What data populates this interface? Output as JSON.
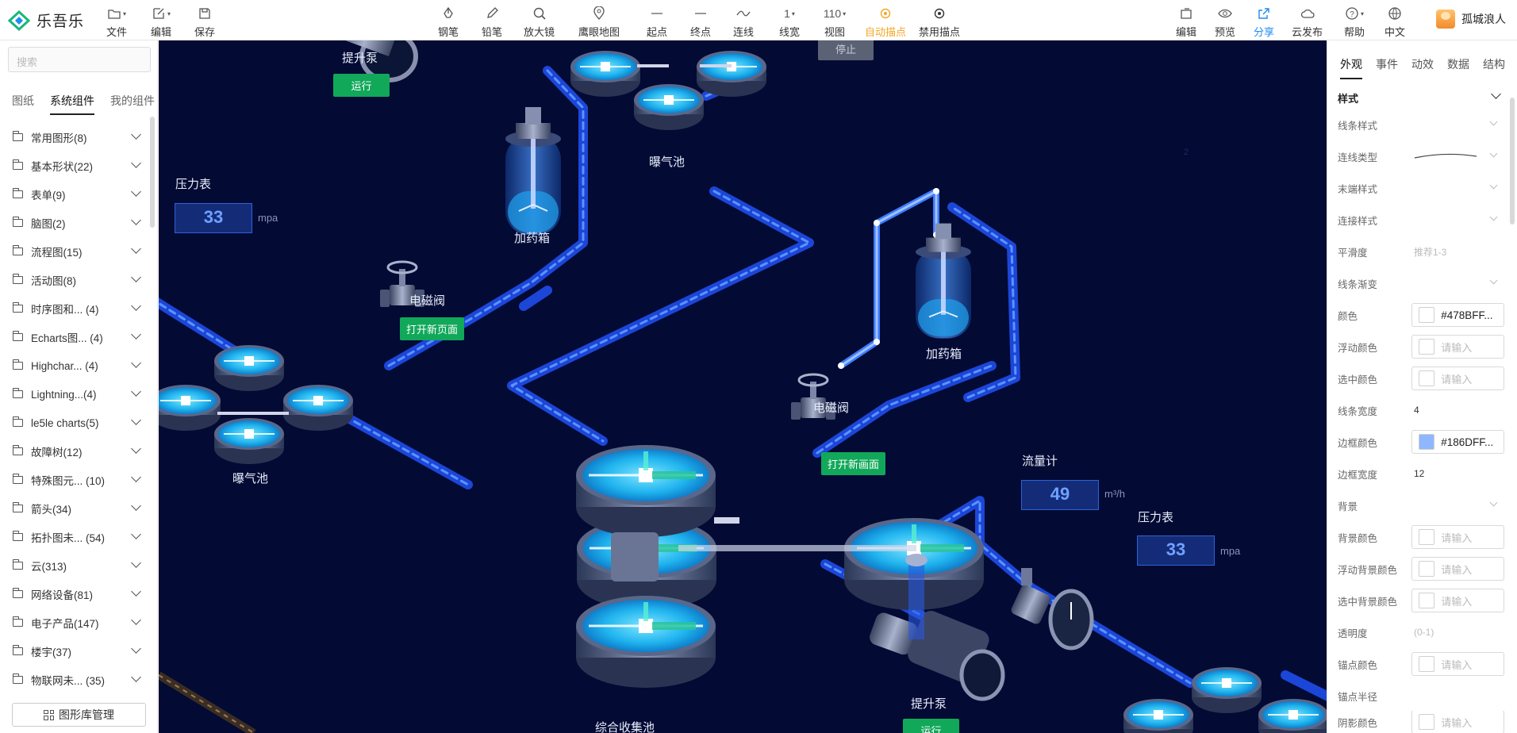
{
  "app": {
    "name": "乐吾乐"
  },
  "toolbar": {
    "file": "文件",
    "edit": "编辑",
    "save": "保存",
    "pen": "钢笔",
    "pencil": "铅笔",
    "magnifier": "放大镜",
    "eagle_map": "鹰眼地图",
    "start": "起点",
    "end": "终点",
    "line": "连线",
    "line_width_value": "1",
    "line_width": "线宽",
    "zoom_value": "110",
    "view": "视图",
    "auto_anchor": "自动描点",
    "disable_anchor": "禁用描点",
    "edit2": "编辑",
    "preview": "预览",
    "share": "分享",
    "publish": "云发布",
    "help": "帮助",
    "lang": "中文"
  },
  "user": {
    "name": "孤城浪人"
  },
  "left": {
    "search_placeholder": "搜索",
    "tabs": [
      "图纸",
      "系统组件",
      "我的组件"
    ],
    "categories": [
      "常用图形(8)",
      "基本形状(22)",
      "表单(9)",
      "脑图(2)",
      "流程图(15)",
      "活动图(8)",
      "时序图和... (4)",
      "Echarts图... (4)",
      "Highchar... (4)",
      "Lightning...(4)",
      "le5le charts(5)",
      "故障树(12)",
      "特殊图元... (10)",
      "箭头(34)",
      "拓扑图未... (54)",
      "云(313)",
      "网络设备(81)",
      "电子产品(147)",
      "楼宇(37)",
      "物联网未... (35)"
    ],
    "library_button": "图形库管理"
  },
  "canvas": {
    "stop_label": "停止",
    "pump_top_label": "提升泵",
    "run_top": "运行",
    "pressure1_label": "压力表",
    "pressure1_value": "33",
    "unit_mpa": "mpa",
    "dosing1_label": "加药箱",
    "valve1_label": "电磁阀",
    "open_page_btn": "打开新页面",
    "aeration_top_label": "曝气池",
    "aeration_left_label": "曝气池",
    "dosing2_label": "加药箱",
    "valve2_label": "电磁阀",
    "open_screen_btn": "打开新画面",
    "flowmeter_label": "流量计",
    "flow_value": "49",
    "unit_flow": "m³/h",
    "pressure2_label": "压力表",
    "pressure2_value": "33",
    "pump_bottom_label": "提升泵",
    "run_bottom": "运行",
    "collector_label": "综合收集池",
    "small_number": "2"
  },
  "right": {
    "tabs": [
      "外观",
      "事件",
      "动效",
      "数据",
      "结构"
    ],
    "style_header": "样式",
    "line_style": "线条样式",
    "connect_type": "连线类型",
    "end_style": "末端样式",
    "join_style": "连接样式",
    "smoothness": "平滑度",
    "smoothness_hint": "推荐1-3",
    "line_gradient": "线条渐变",
    "color": "颜色",
    "color_value": "#478BFF...",
    "color_hex": "#478bff",
    "hover_color": "浮动颜色",
    "selected_color": "选中颜色",
    "input_placeholder": "请输入",
    "line_width": "线条宽度",
    "line_width_value": "4",
    "border_color": "边框颜色",
    "border_color_value": "#186DFF...",
    "border_color_hex": "#8fb7ff",
    "border_width": "边框宽度",
    "border_width_value": "12",
    "background": "背景",
    "bg_color": "背景颜色",
    "hover_bg_color": "浮动背景颜色",
    "selected_bg_color": "选中背景颜色",
    "opacity": "透明度",
    "opacity_hint": "(0-1)",
    "anchor_color": "锚点颜色",
    "anchor_radius": "锚点半径",
    "shadow_color": "阴影颜色"
  },
  "colors": {
    "canvas_bg": "#030a33",
    "pipe": "#1c46d8",
    "pipe_dash": "#5b93ff",
    "accent": "#1f8cf0",
    "green": "#11a85a"
  }
}
